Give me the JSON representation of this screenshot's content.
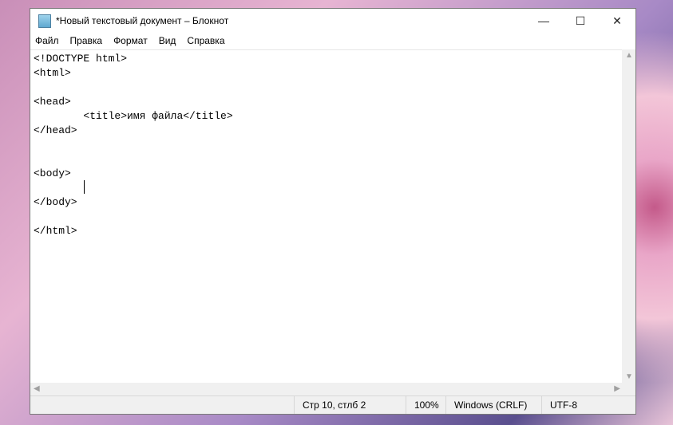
{
  "window": {
    "title": "*Новый текстовый документ – Блокнот",
    "minimize": "—",
    "maximize": "☐",
    "close": "✕"
  },
  "menu": [
    "Файл",
    "Правка",
    "Формат",
    "Вид",
    "Справка"
  ],
  "editor": {
    "content": "<!DOCTYPE html>\n<html>\n\n<head>\n\t<title>имя файла</title>\n</head>\n\n\n<body>\n\t\n</body>\n\n</html>"
  },
  "status": {
    "position": "Стр 10, стлб 2",
    "zoom": "100%",
    "line_ending": "Windows (CRLF)",
    "encoding": "UTF-8"
  }
}
